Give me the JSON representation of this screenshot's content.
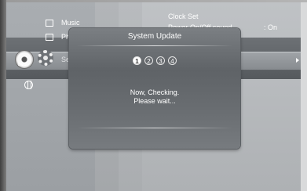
{
  "menu": {
    "items": [
      {
        "label": "Music",
        "icon": "music-note-icon"
      },
      {
        "label": "Ph",
        "icon": "photo-icon"
      },
      {
        "label": "Se",
        "icon": "gear-icon"
      }
    ],
    "side_icons": [
      "dvd-disc-icon",
      "setup-gear-icon",
      "globe-icon"
    ]
  },
  "dvd_badge": "DVD",
  "content": {
    "clock_set": "Clock Set",
    "power_sound_label": "Power On/Off sound",
    "power_sound_value": ": On"
  },
  "dialog": {
    "title": "System Update",
    "steps": [
      "1",
      "2",
      "3",
      "4"
    ],
    "active_step": "1",
    "message_line1": "Now, Checking.",
    "message_line2": "Please wait..."
  },
  "colors": {
    "dialog_bg": "#5f6367",
    "text": "#ffffff",
    "selection_band": "#878b8f"
  }
}
